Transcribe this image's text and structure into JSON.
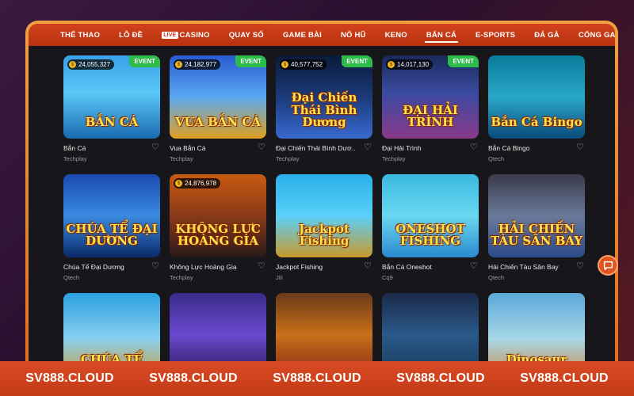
{
  "nav": {
    "items": [
      {
        "label": "THỂ THAO"
      },
      {
        "label": "LÔ ĐỀ"
      },
      {
        "label": "CASINO",
        "badge": "LIVE"
      },
      {
        "label": "QUAY SỐ"
      },
      {
        "label": "GAME BÀI"
      },
      {
        "label": "NỔ HŨ"
      },
      {
        "label": "KENO"
      },
      {
        "label": "BẮN CÁ",
        "active": true
      },
      {
        "label": "E-SPORTS"
      },
      {
        "label": "ĐÁ GÀ"
      },
      {
        "label": "CỔNG GAMES"
      }
    ]
  },
  "games": [
    {
      "name": "Bắn Cá",
      "provider": "Techplay",
      "jackpot": "24,055,327",
      "event": "EVENT",
      "art": "BẮN CÁ"
    },
    {
      "name": "Vua Bắn Cá",
      "provider": "Techplay",
      "jackpot": "24,182,977",
      "event": "EVENT",
      "art": "VUA BẮN CÁ"
    },
    {
      "name": "Đại Chiến Thái Bình Dươ...",
      "provider": "Techplay",
      "jackpot": "40,577,752",
      "event": "EVENT",
      "art": "Đại Chiến Thái Bình Dương"
    },
    {
      "name": "Đại Hải Trình",
      "provider": "Techplay",
      "jackpot": "14,017,130",
      "event": "EVENT",
      "art": "ĐẠI HẢI TRÌNH"
    },
    {
      "name": "Bắn Cá Bingo",
      "provider": "Qtech",
      "jackpot": "",
      "event": "",
      "art": "Bắn Cá Bingo"
    },
    {
      "name": "Chúa Tể Đại Dương",
      "provider": "Qtech",
      "jackpot": "",
      "event": "",
      "art": "CHÚA TỂ ĐẠI DƯƠNG"
    },
    {
      "name": "Không Lực Hoàng Gia",
      "provider": "Techplay",
      "jackpot": "24,876,978",
      "event": "",
      "art": "KHÔNG LỰC HOÀNG GIA"
    },
    {
      "name": "Jackpot Fishing",
      "provider": "Jili",
      "jackpot": "",
      "event": "",
      "art": "Jackpot Fishing"
    },
    {
      "name": "Bắn Cá Oneshot",
      "provider": "Cq9",
      "jackpot": "",
      "event": "",
      "art": "ONESHOT FISHING"
    },
    {
      "name": "Hải Chiến Tàu Sân Bay",
      "provider": "Qtech",
      "jackpot": "",
      "event": "",
      "art": "HẢI CHIẾN TÀU SÂN BAY"
    },
    {
      "name": "",
      "provider": "",
      "jackpot": "",
      "event": "",
      "art": "CHÚA TỂ"
    },
    {
      "name": "",
      "provider": "",
      "jackpot": "",
      "event": "",
      "art": ""
    },
    {
      "name": "",
      "provider": "",
      "jackpot": "",
      "event": "",
      "art": ""
    },
    {
      "name": "",
      "provider": "",
      "jackpot": "",
      "event": "",
      "art": ""
    },
    {
      "name": "",
      "provider": "",
      "jackpot": "",
      "event": "",
      "art": "Dinosaur"
    }
  ],
  "footer": {
    "watermarks": [
      "SV888.CLOUD",
      "SV888.CLOUD",
      "SV888.CLOUD",
      "SV888.CLOUD",
      "SV888.CLOUD"
    ]
  },
  "colors": {
    "nav_bg": "#c9391a",
    "event_badge": "#2dbb4a",
    "frame": "#e8852e",
    "footer": "#d04420"
  },
  "icons": {
    "favorite": "heart-outline-icon",
    "chat": "chat-bubble-icon",
    "jackpot_coin": "dollar-coin-icon"
  }
}
